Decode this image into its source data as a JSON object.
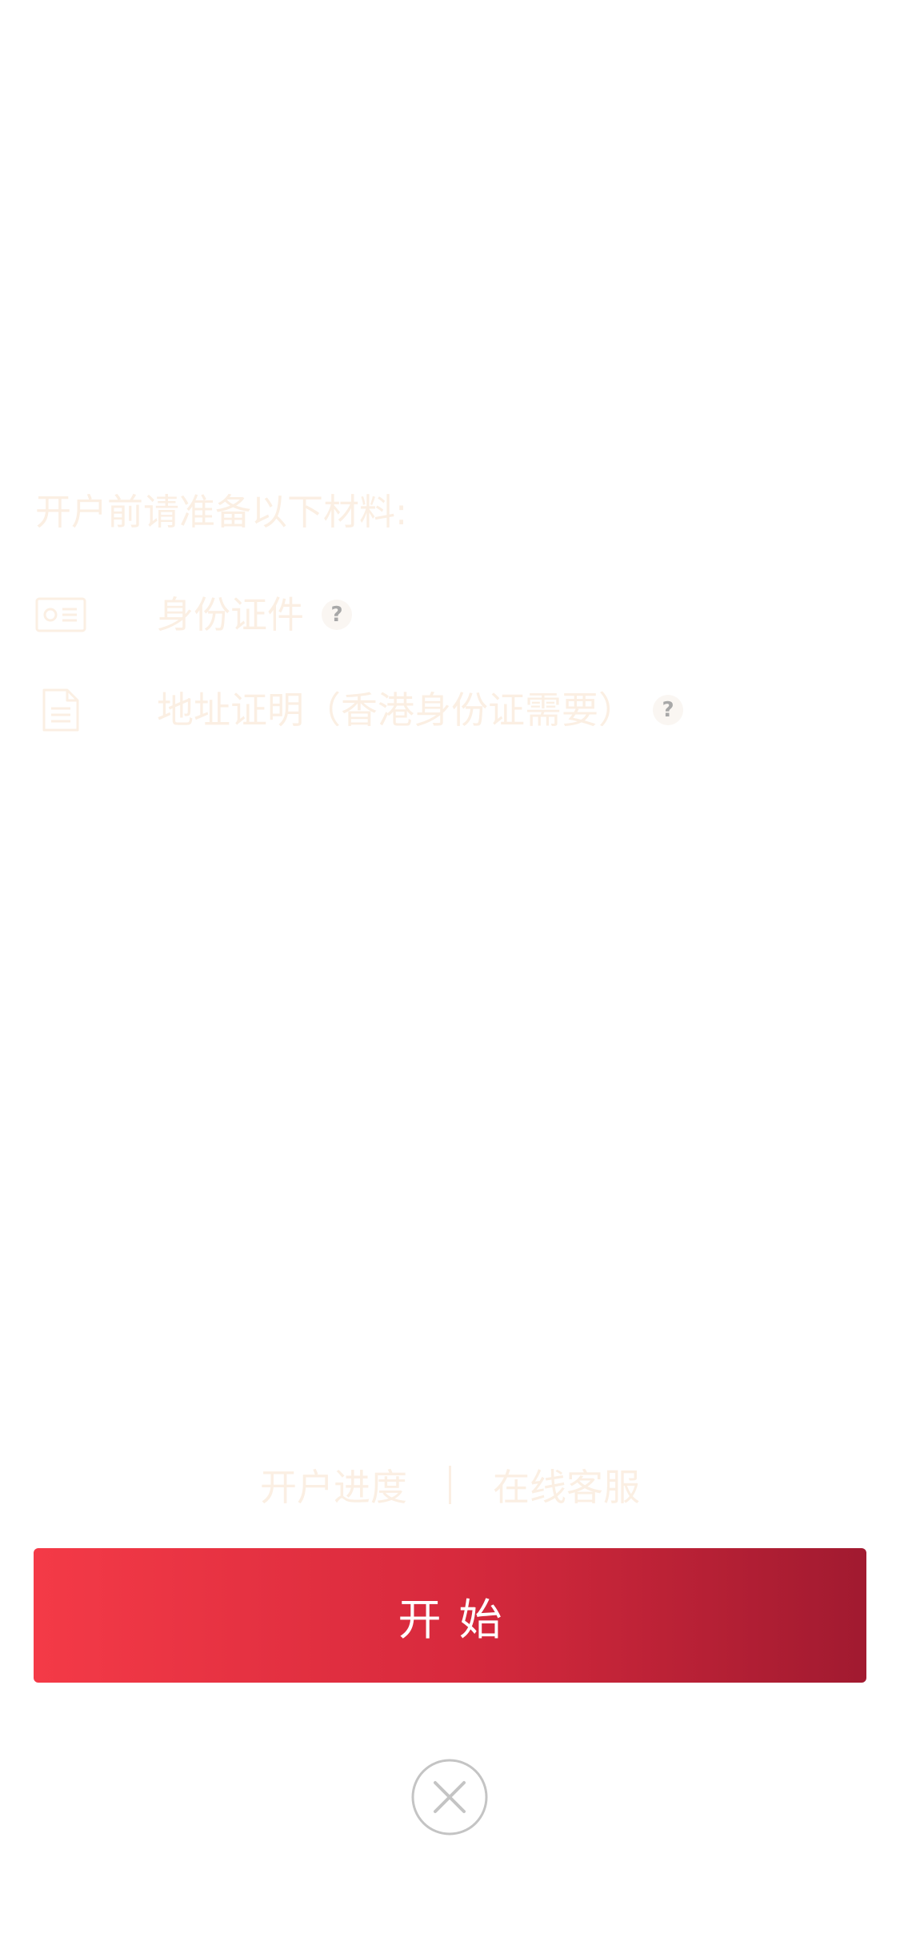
{
  "materials": {
    "title": "开户前请准备以下材料:",
    "items": [
      {
        "label": "身份证件",
        "icon": "id-card-icon",
        "help_icon": "question-icon",
        "help_symbol": "?"
      },
      {
        "label": "地址证明（香港身份证需要）",
        "icon": "document-icon",
        "help_icon": "question-icon",
        "help_symbol": "?"
      }
    ]
  },
  "footer": {
    "progress_label": "开户进度",
    "service_label": "在线客服"
  },
  "actions": {
    "start_label": "开始",
    "close_icon": "close-icon"
  },
  "colors": {
    "faded_text": "#fbefe3",
    "button_gradient_start": "#f43a47",
    "button_gradient_end": "#a11a30",
    "button_text": "#ffffff",
    "close_icon": "#c4c4c4"
  }
}
